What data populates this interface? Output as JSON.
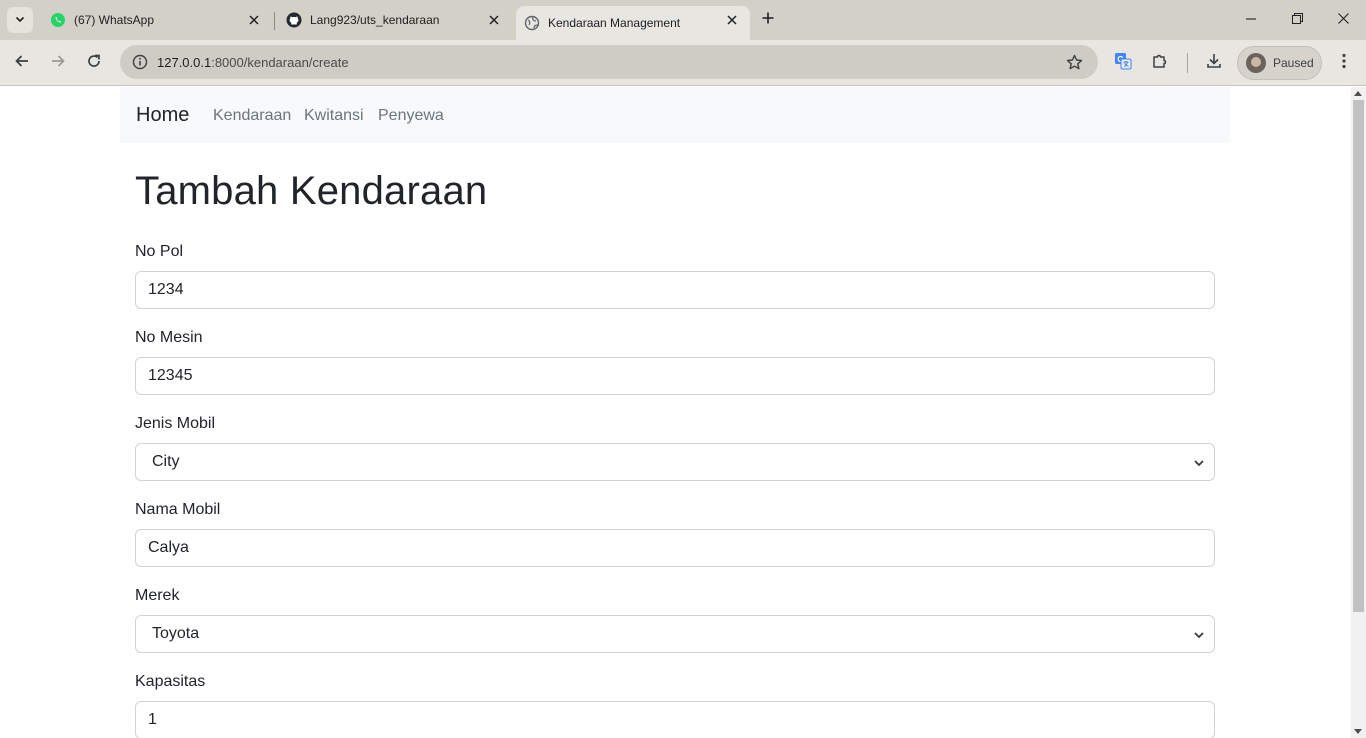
{
  "browser": {
    "tabs": [
      {
        "title": "(67) WhatsApp",
        "icon": "whatsapp-icon"
      },
      {
        "title": "Lang923/uts_kendaraan",
        "icon": "github-icon"
      },
      {
        "title": "Kendaraan Management",
        "icon": "globe-icon",
        "active": true
      }
    ],
    "url_host": "127.0.0.1",
    "url_path": ":8000/kendaraan/create",
    "profile_label": "Paused"
  },
  "navbar": {
    "brand": "Home",
    "links": [
      "Kendaraan",
      "Kwitansi",
      "Penyewa"
    ]
  },
  "page": {
    "title": "Tambah Kendaraan"
  },
  "form": {
    "no_pol": {
      "label": "No Pol",
      "value": "1234"
    },
    "no_mesin": {
      "label": "No Mesin",
      "value": "12345"
    },
    "jenis_mobil": {
      "label": "Jenis Mobil",
      "selected": "City"
    },
    "nama_mobil": {
      "label": "Nama Mobil",
      "value": "Calya"
    },
    "merek": {
      "label": "Merek",
      "selected": "Toyota"
    },
    "kapasitas": {
      "label": "Kapasitas",
      "value": "1"
    }
  },
  "colors": {
    "tabstrip": "#d3d0c8",
    "toolbar": "#e8e6e1",
    "navbar_bg": "#f8f9fa",
    "nav_link": "#6c757d",
    "input_border": "#ced4da",
    "text": "#212529"
  }
}
